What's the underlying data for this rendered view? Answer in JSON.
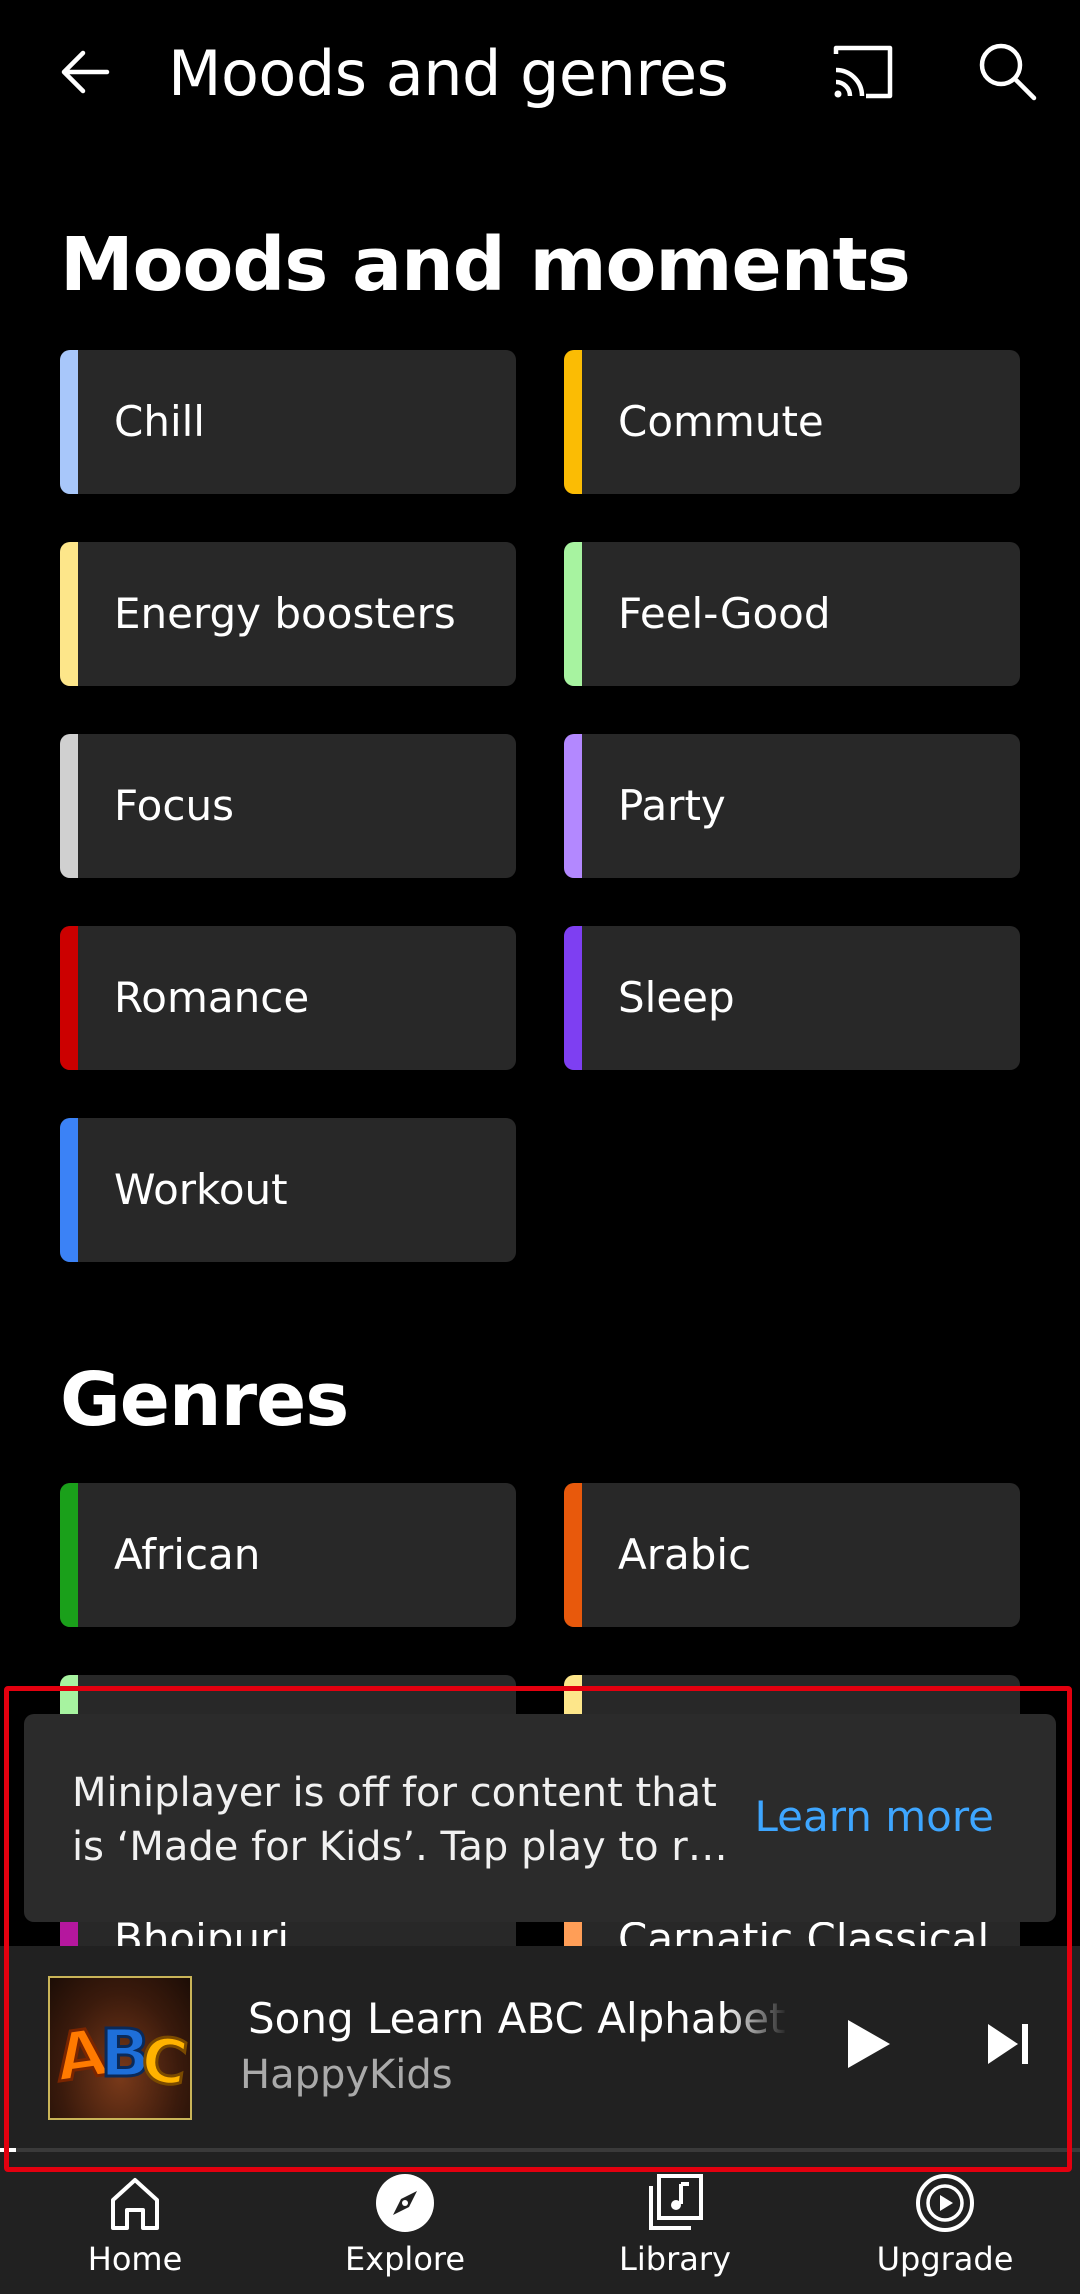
{
  "header": {
    "title": "Moods and genres"
  },
  "moods": {
    "heading": "Moods and moments",
    "items": [
      {
        "label": "Chill",
        "color": "#a8c7fa"
      },
      {
        "label": "Commute",
        "color": "#fbbc04"
      },
      {
        "label": "Energy boosters",
        "color": "#fde68a"
      },
      {
        "label": "Feel-Good",
        "color": "#a7f3a0"
      },
      {
        "label": "Focus",
        "color": "#d0d0d0"
      },
      {
        "label": "Party",
        "color": "#b388ff"
      },
      {
        "label": "Romance",
        "color": "#cc0000"
      },
      {
        "label": "Sleep",
        "color": "#7e3ff2"
      },
      {
        "label": "Workout",
        "color": "#3b82f6"
      }
    ]
  },
  "genres": {
    "heading": "Genres",
    "items": [
      {
        "label": "African",
        "color": "#1aa01a"
      },
      {
        "label": "Arabic",
        "color": "#e8590c"
      },
      {
        "label": "Bhojpuri",
        "color": "#b5179e"
      },
      {
        "label": "Carnatic Classical",
        "color": "#ff9e57"
      }
    ]
  },
  "toast": {
    "line1": "Miniplayer is off for content that",
    "line2": "is ‘Made for Kids’. Tap play to r…",
    "action": "Learn more"
  },
  "miniplayer": {
    "thumbnail_text": "ABC",
    "song_title": " Song Learn ABC Alphabet for Children",
    "artist": "HappyKids",
    "progress": 0.015
  },
  "bottom_nav": {
    "items": [
      {
        "label": "Home",
        "icon": "home-icon"
      },
      {
        "label": "Explore",
        "icon": "explore-icon",
        "active": true
      },
      {
        "label": "Library",
        "icon": "library-icon"
      },
      {
        "label": "Upgrade",
        "icon": "upgrade-icon"
      }
    ]
  }
}
